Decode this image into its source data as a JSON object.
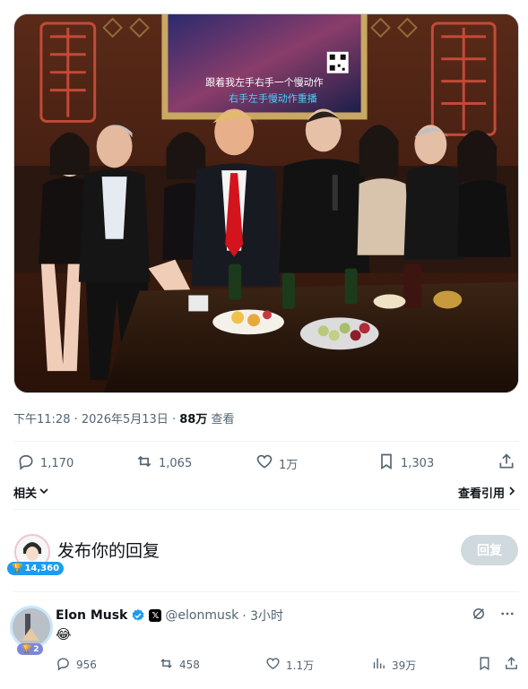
{
  "tweet": {
    "tv_caption_line1": "跟着我左手右手一个慢动作",
    "tv_caption_line2": "右手左手慢动作重播",
    "time": "下午11:28",
    "dot": "·",
    "date": "2026年5月13日",
    "views_count": "88万",
    "views_label": "查看",
    "actions": {
      "replies": "1,170",
      "retweets": "1,065",
      "likes": "1万",
      "bookmarks": "1,303"
    },
    "related_label": "相关",
    "view_quotes_label": "查看引用"
  },
  "composer": {
    "badge_count": "14,360",
    "placeholder": "发布你的回复",
    "reply_button": "回复"
  },
  "reply": {
    "name": "Elon Musk",
    "x_badge": "𝕏",
    "handle": "@elonmusk",
    "time": "· 3小时",
    "text": "😂",
    "badge_count": "2",
    "actions": {
      "replies": "956",
      "retweets": "458",
      "likes": "1.1万",
      "views": "39万"
    }
  },
  "colors": {
    "verified": "#1d9bf0",
    "muted_text": "#536471",
    "reply_button_bg": "#cfd9de"
  }
}
